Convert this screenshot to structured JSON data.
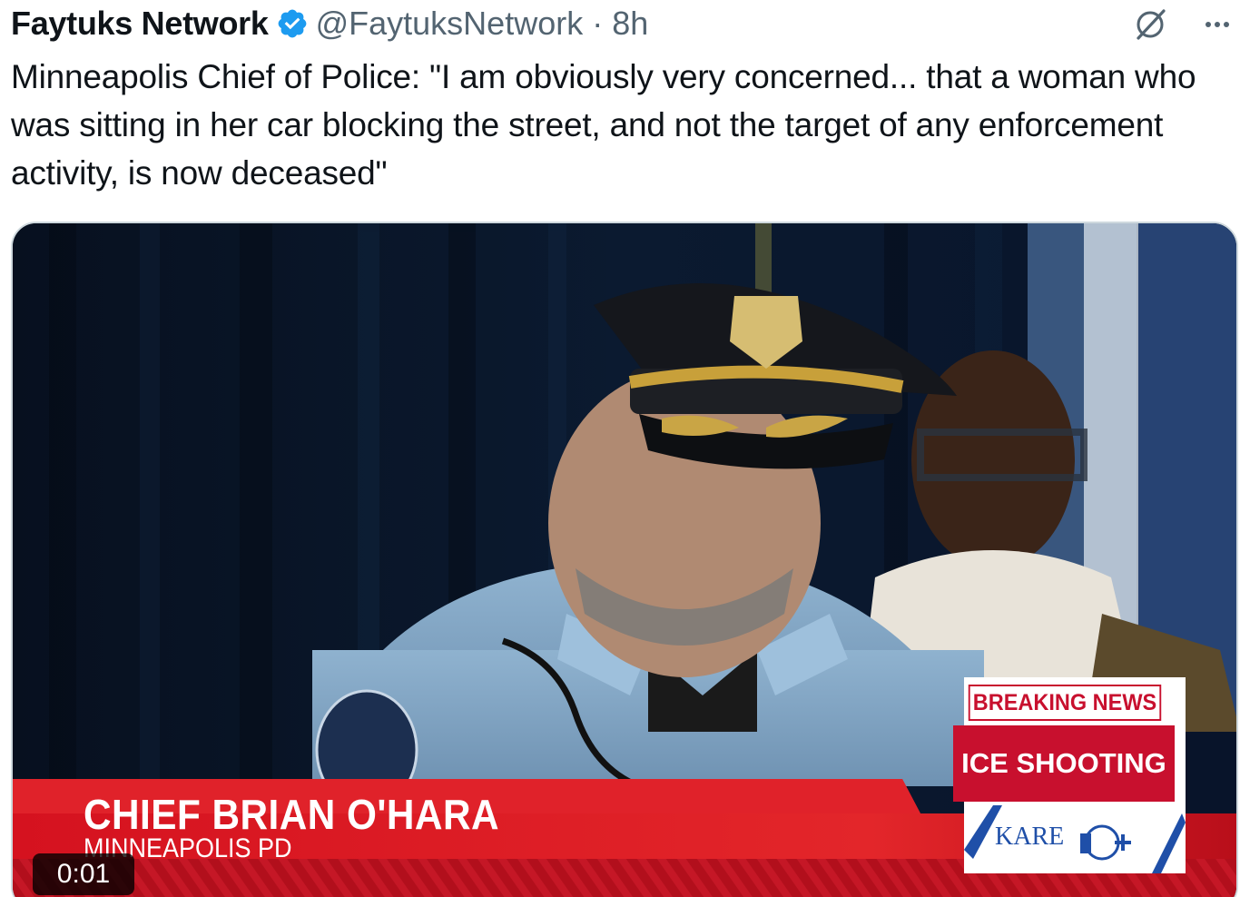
{
  "tweet": {
    "display_name": "Faytuks Network",
    "handle_time": "@FaytuksNetwork · 8h",
    "text": "Minneapolis Chief of Police: \"I am obviously very concerned... that a woman who was sitting in her car blocking the street, and not the target of any enforcement activity, is now deceased\""
  },
  "actions": {
    "grok_icon": "grok-icon",
    "more_icon": "more-icon"
  },
  "video": {
    "timestamp": "0:01",
    "lower_third_name": "CHIEF BRIAN O'HARA",
    "lower_third_org": "MINNEAPOLIS PD",
    "breaking_label": "BREAKING NEWS",
    "story_label": "ICE SHOOTING",
    "station": "KARE"
  },
  "colors": {
    "verified_blue": "#1d9bf0",
    "news_red": "#c8102e",
    "station_blue": "#1f4fa8",
    "muted_text": "#536471"
  }
}
